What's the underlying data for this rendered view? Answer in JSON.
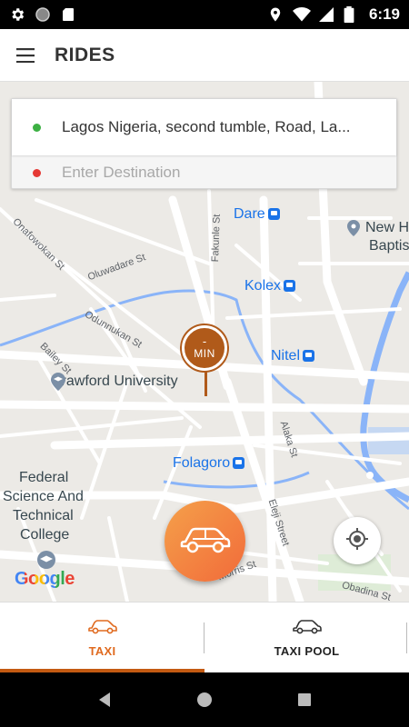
{
  "status_bar": {
    "time": "6:19",
    "left_icons": [
      "settings-icon",
      "circle-icon",
      "sd-card-icon"
    ],
    "right_icons": [
      "location-icon",
      "wifi-icon",
      "signal-icon",
      "battery-icon"
    ]
  },
  "app_bar": {
    "title": "RIDES",
    "menu_icon": "hamburger-menu-icon"
  },
  "search": {
    "pickup": "Lagos Nigeria, second tumble, Road, La...",
    "pickup_dot_color": "#3cb043",
    "destination_placeholder": "Enter Destination",
    "destination_value": "",
    "destination_dot_color": "#e53935"
  },
  "map": {
    "places": [
      {
        "name": "Dare",
        "type": "transit"
      },
      {
        "name": "New H",
        "type": "landmark"
      },
      {
        "name": "Baptis",
        "type": "landmark"
      },
      {
        "name": "Kolex",
        "type": "transit"
      },
      {
        "name": "Nitel",
        "type": "transit"
      },
      {
        "name": "Crawford University",
        "type": "school"
      },
      {
        "name": "Folagoro",
        "type": "transit"
      },
      {
        "name": "Federal",
        "type": "school"
      },
      {
        "name": "Science And",
        "type": "school"
      },
      {
        "name": "Technical",
        "type": "school"
      },
      {
        "name": "College",
        "type": "school"
      }
    ],
    "streets": [
      "Onafowokan St",
      "Oluwadare St",
      "Fakunle St",
      "Odunnukan St",
      "Bailey St",
      "Alaka St",
      "Eleji Street",
      "Morris St",
      "Obadina St"
    ],
    "pin": {
      "value": "-",
      "unit": "MIN"
    },
    "attribution": "Google"
  },
  "fab": {
    "icon": "car-icon"
  },
  "locate": {
    "icon": "my-location-icon"
  },
  "tabs": [
    {
      "label": "TAXI",
      "icon": "car-outline-icon",
      "active": true
    },
    {
      "label": "TAXI POOL",
      "icon": "car-outline-icon",
      "active": false
    }
  ],
  "nav": {
    "back": "back-icon",
    "home": "home-icon",
    "recents": "recents-icon"
  },
  "colors": {
    "accent": "#e06a1f",
    "pin": "#b05a1a",
    "fab_start": "#f4a04a",
    "fab_end": "#f26b3a",
    "water": "#8ab4f8"
  }
}
